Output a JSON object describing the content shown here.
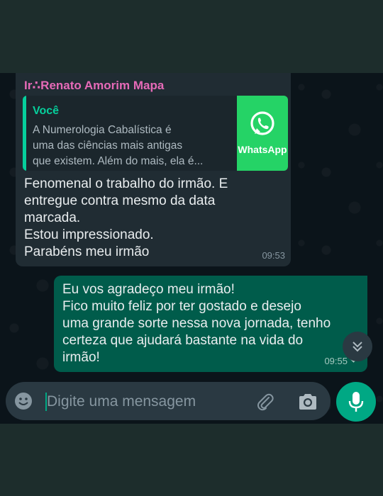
{
  "incoming": {
    "sender": "Ir∴Renato Amorim Mapa",
    "quote": {
      "author": "Você",
      "text_lines": [
        "A Numerologia Cabalística é",
        "uma das ciências mais antigas",
        "que existem. Além do mais, ela é..."
      ],
      "thumb_label": "WhatsApp"
    },
    "body_lines": [
      "Fenomenal o trabalho do irmão.  E",
      "entregue contra mesmo da data",
      "marcada.",
      "Estou impressionado.",
      "Parabéns meu irmão"
    ],
    "time": "09:53"
  },
  "outgoing": {
    "body_lines": [
      "Eu vos agradeço meu irmão!",
      "Fico muito feliz por ter gostado e desejo",
      "uma grande sorte nessa nova jornada, tenho",
      "certeza que ajudará bastante na vida do",
      "irmão!"
    ],
    "time": "09:55",
    "status_icon": "chevron-down-icon"
  },
  "composer": {
    "placeholder": "Digite uma mensagem",
    "value": ""
  },
  "colors": {
    "incoming_bubble": "#202c33",
    "outgoing_bubble": "#005c4b",
    "accent": "#00a884",
    "sender_name": "#e66ab8"
  }
}
